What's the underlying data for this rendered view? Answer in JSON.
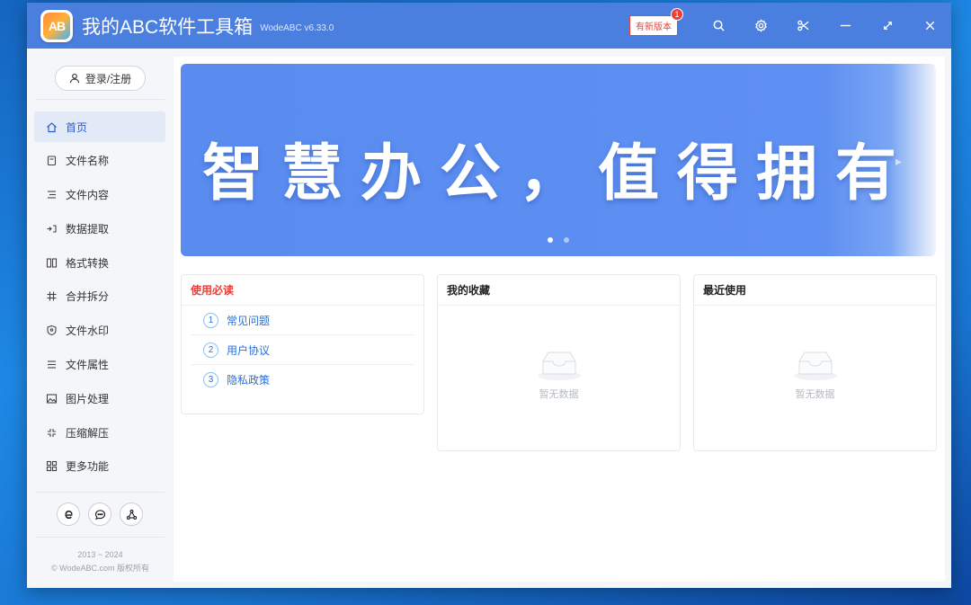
{
  "app": {
    "logo_text": "AB",
    "title": "我的ABC软件工具箱",
    "version": "WodeABC v6.33.0",
    "new_version_label": "有新版本",
    "new_version_badge": "1"
  },
  "sidebar": {
    "login_label": "登录/注册",
    "items": [
      {
        "label": "首页",
        "icon": "home-icon",
        "active": true
      },
      {
        "label": "文件名称",
        "icon": "file-name-icon"
      },
      {
        "label": "文件内容",
        "icon": "file-content-icon"
      },
      {
        "label": "数据提取",
        "icon": "data-extract-icon"
      },
      {
        "label": "格式转换",
        "icon": "format-convert-icon"
      },
      {
        "label": "合并拆分",
        "icon": "merge-split-icon"
      },
      {
        "label": "文件水印",
        "icon": "watermark-icon"
      },
      {
        "label": "文件属性",
        "icon": "file-property-icon"
      },
      {
        "label": "图片处理",
        "icon": "image-process-icon"
      },
      {
        "label": "压缩解压",
        "icon": "compress-icon"
      },
      {
        "label": "更多功能",
        "icon": "more-features-icon"
      }
    ],
    "copyright_years": "2013 ~ 2024",
    "copyright_text": "© WodeABC.com 版权所有"
  },
  "banner": {
    "text": "智慧办公，值得拥有"
  },
  "cards": {
    "guide": {
      "title": "使用必读",
      "items": [
        {
          "num": "1",
          "label": "常见问题"
        },
        {
          "num": "2",
          "label": "用户协议"
        },
        {
          "num": "3",
          "label": "隐私政策"
        }
      ]
    },
    "favorites": {
      "title": "我的收藏",
      "empty": "暂无数据"
    },
    "recent": {
      "title": "最近使用",
      "empty": "暂无数据"
    }
  },
  "colors": {
    "titlebar": "#4a7fe0",
    "accent": "#2d5bd1",
    "alert": "#e8413a"
  }
}
